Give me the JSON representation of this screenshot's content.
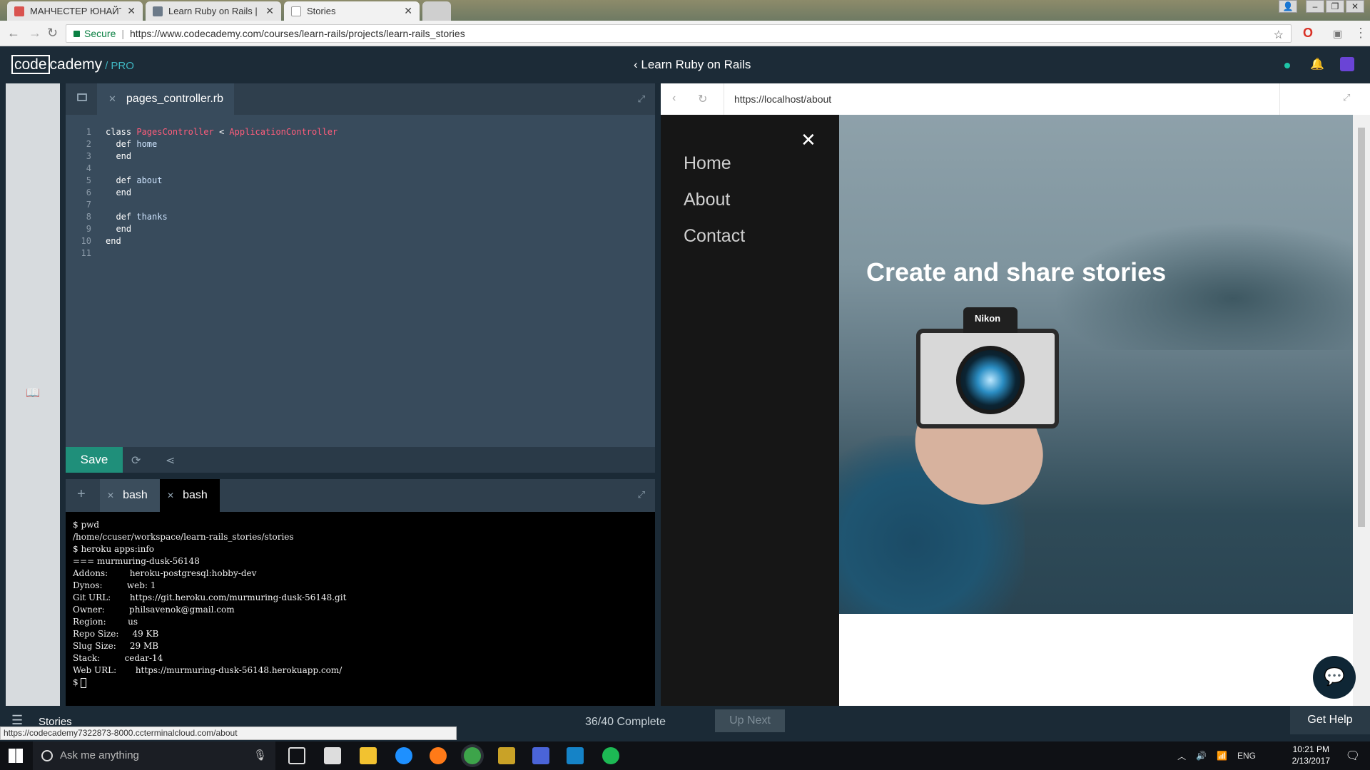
{
  "browser": {
    "tabs": [
      {
        "label": "МАНЧЕСТЕР ЮНАЙТЕД",
        "color": "#d9534f"
      },
      {
        "label": "Learn Ruby on Rails | Co",
        "color": "#6c7a89"
      },
      {
        "label": "Stories",
        "color": "#ffffff"
      }
    ],
    "secure_label": "Secure",
    "url": "https://www.codecademy.com/courses/learn-rails/projects/learn-rails_stories"
  },
  "header": {
    "logo_code": "code",
    "logo_cademy": "cademy",
    "logo_pro": "/ PRO",
    "course_title": "Learn Ruby on Rails"
  },
  "editor": {
    "file_tab": "pages_controller.rb",
    "lines": [
      {
        "n": "1",
        "parts": [
          [
            "k",
            "class "
          ],
          [
            "cls",
            "PagesController"
          ],
          [
            "k",
            " < "
          ],
          [
            "cls",
            "ApplicationController"
          ]
        ]
      },
      {
        "n": "2",
        "parts": [
          [
            "k",
            "  def "
          ],
          [
            "m",
            "home"
          ]
        ]
      },
      {
        "n": "3",
        "parts": [
          [
            "k",
            "  end"
          ]
        ]
      },
      {
        "n": "4",
        "parts": []
      },
      {
        "n": "5",
        "parts": [
          [
            "k",
            "  def "
          ],
          [
            "m",
            "about"
          ]
        ]
      },
      {
        "n": "6",
        "parts": [
          [
            "k",
            "  end"
          ]
        ]
      },
      {
        "n": "7",
        "parts": []
      },
      {
        "n": "8",
        "parts": [
          [
            "k",
            "  def "
          ],
          [
            "m",
            "thanks"
          ]
        ]
      },
      {
        "n": "9",
        "parts": [
          [
            "k",
            "  end"
          ]
        ]
      },
      {
        "n": "10",
        "parts": [
          [
            "k",
            "end"
          ]
        ]
      },
      {
        "n": "11",
        "parts": []
      }
    ],
    "save_label": "Save"
  },
  "terminal": {
    "tabs": [
      "bash",
      "bash"
    ],
    "lines": [
      "$ pwd",
      "/home/ccuser/workspace/learn-rails_stories/stories",
      "$ heroku apps:info",
      "=== murmuring-dusk-56148",
      "Addons:        heroku-postgresql:hobby-dev",
      "Dynos:         web: 1",
      "Git URL:       https://git.heroku.com/murmuring-dusk-56148.git",
      "Owner:         philsavenok@gmail.com",
      "Region:        us",
      "Repo Size:     49 KB",
      "Slug Size:     29 MB",
      "Stack:         cedar-14",
      "Web URL:       https://murmuring-dusk-56148.herokuapp.com/",
      "$ "
    ]
  },
  "preview": {
    "url": "https://localhost/about",
    "menu": [
      "Home",
      "About",
      "Contact"
    ],
    "hero_title": "Create and share stories",
    "camera_brand": "Nikon"
  },
  "footer": {
    "lesson": "Stories",
    "progress": "36/40 Complete",
    "up_next": "Up Next",
    "get_help": "Get Help",
    "status_url": "https://codecademy7322873-8000.ccterminalcloud.com/about"
  },
  "taskbar": {
    "search_placeholder": "Ask me anything",
    "lang": "ENG",
    "time": "10:21 PM",
    "date": "2/13/2017"
  }
}
